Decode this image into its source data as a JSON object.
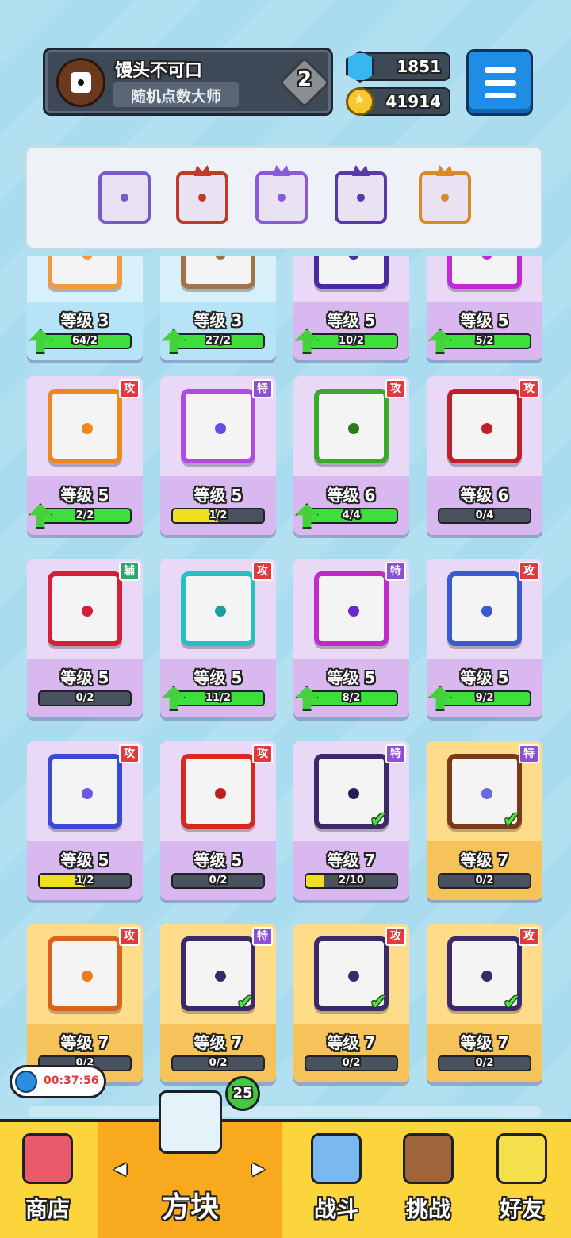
{
  "player": {
    "name": "馒头不可口",
    "title": "随机点数大师",
    "rank": "2"
  },
  "currency": {
    "gems": "1851",
    "coins": "41914"
  },
  "deck": [
    {
      "color": "#7a58c9",
      "icon": "dice-icon",
      "horn": false
    },
    {
      "color": "#c0392b",
      "icon": "dice-icon",
      "horn": true
    },
    {
      "color": "#8a5bd6",
      "icon": "dice-icon",
      "horn": true
    },
    {
      "color": "#5b3aa8",
      "icon": "dice-icon",
      "horn": true
    },
    {
      "color": "#d88a2a",
      "icon": "dice-icon",
      "horn": true
    }
  ],
  "cards": [
    {
      "level": "等级 3",
      "progress": "64/2",
      "fill": 1,
      "up": true,
      "bg": "blue",
      "color": "#f39a3d",
      "pip": "#f39a3d",
      "tag": "",
      "tagType": "",
      "check": false
    },
    {
      "level": "等级 3",
      "progress": "27/2",
      "fill": 1,
      "up": true,
      "bg": "blue",
      "color": "#a07448",
      "pip": "#a07448",
      "tag": "",
      "tagType": "",
      "check": false
    },
    {
      "level": "等级 5",
      "progress": "10/2",
      "fill": 1,
      "up": true,
      "bg": "purple",
      "color": "#4a2aa0",
      "pip": "#4a2aa0",
      "tag": "",
      "tagType": "",
      "check": false
    },
    {
      "level": "等级 5",
      "progress": "5/2",
      "fill": 1,
      "up": true,
      "bg": "purple",
      "color": "#c02ad4",
      "pip": "#c02ad4",
      "tag": "",
      "tagType": "",
      "check": false
    },
    {
      "level": "等级 5",
      "progress": "2/2",
      "fill": 1,
      "up": true,
      "bg": "purple",
      "color": "#f0861e",
      "pip": "#f0861e",
      "tag": "攻",
      "tagType": "atk",
      "check": false
    },
    {
      "level": "等级 5",
      "progress": "1/2",
      "fill": 0.5,
      "up": false,
      "bg": "purple",
      "color": "#b04ae0",
      "pip": "#6a4ae0",
      "tag": "特",
      "tagType": "spc",
      "check": false
    },
    {
      "level": "等级 6",
      "progress": "4/4",
      "fill": 1,
      "up": true,
      "bg": "purple",
      "color": "#3aaa2a",
      "pip": "#2a7a1a",
      "tag": "攻",
      "tagType": "atk",
      "check": false
    },
    {
      "level": "等级 6",
      "progress": "0/4",
      "fill": 0,
      "up": false,
      "bg": "purple",
      "color": "#c0202a",
      "pip": "#c0202a",
      "tag": "攻",
      "tagType": "atk",
      "check": false
    },
    {
      "level": "等级 5",
      "progress": "0/2",
      "fill": 0,
      "up": false,
      "bg": "purple",
      "color": "#d41e3a",
      "pip": "#d41e3a",
      "tag": "辅",
      "tagType": "sup",
      "check": false
    },
    {
      "level": "等级 5",
      "progress": "11/2",
      "fill": 1,
      "up": true,
      "bg": "purple",
      "color": "#26c0c0",
      "pip": "#1aa0a0",
      "tag": "攻",
      "tagType": "atk",
      "check": false
    },
    {
      "level": "等级 5",
      "progress": "8/2",
      "fill": 1,
      "up": true,
      "bg": "purple",
      "color": "#c02ac8",
      "pip": "#6a2ad0",
      "tag": "特",
      "tagType": "spc",
      "check": false
    },
    {
      "level": "等级 5",
      "progress": "9/2",
      "fill": 1,
      "up": true,
      "bg": "purple",
      "color": "#3a5ad0",
      "pip": "#3a5ad0",
      "tag": "攻",
      "tagType": "atk",
      "check": false
    },
    {
      "level": "等级 5",
      "progress": "1/2",
      "fill": 0.5,
      "up": false,
      "bg": "purple",
      "color": "#3a4ad8",
      "pip": "#6a5ae0",
      "tag": "攻",
      "tagType": "atk",
      "check": false
    },
    {
      "level": "等级 5",
      "progress": "0/2",
      "fill": 0,
      "up": false,
      "bg": "purple",
      "color": "#d8281e",
      "pip": "#c0201a",
      "tag": "攻",
      "tagType": "atk",
      "check": false
    },
    {
      "level": "等级 7",
      "progress": "2/10",
      "fill": 0.2,
      "up": false,
      "bg": "purple",
      "color": "#3a2a6a",
      "pip": "#2a1a5a",
      "tag": "特",
      "tagType": "spc",
      "check": true
    },
    {
      "level": "等级 7",
      "progress": "0/2",
      "fill": 0,
      "up": false,
      "bg": "gold",
      "color": "#7a3a1a",
      "pip": "#6a6ae0",
      "tag": "特",
      "tagType": "spc",
      "check": true
    },
    {
      "level": "等级 7",
      "progress": "0/2",
      "fill": 0,
      "up": false,
      "bg": "gold",
      "color": "#d8641a",
      "pip": "#f07a1a",
      "tag": "攻",
      "tagType": "atk",
      "check": false
    },
    {
      "level": "等级 7",
      "progress": "0/2",
      "fill": 0,
      "up": false,
      "bg": "gold",
      "color": "#3a2a6a",
      "pip": "#3a2a6a",
      "tag": "特",
      "tagType": "spc",
      "check": true
    },
    {
      "level": "等级 7",
      "progress": "0/2",
      "fill": 0,
      "up": false,
      "bg": "gold",
      "color": "#3a2a6a",
      "pip": "#3a2a6a",
      "tag": "攻",
      "tagType": "atk",
      "check": true
    },
    {
      "level": "等级 7",
      "progress": "0/2",
      "fill": 0,
      "up": false,
      "bg": "gold",
      "color": "#3a2a6a",
      "pip": "#3a2a6a",
      "tag": "攻",
      "tagType": "atk",
      "check": true
    }
  ],
  "timer": "00:37:56",
  "nav": {
    "shop": "商店",
    "dice": "方块",
    "dice_badge": "25",
    "battle": "战斗",
    "challenge": "挑战",
    "friends": "好友",
    "arrow_left": "◀",
    "arrow_right": "▶"
  }
}
